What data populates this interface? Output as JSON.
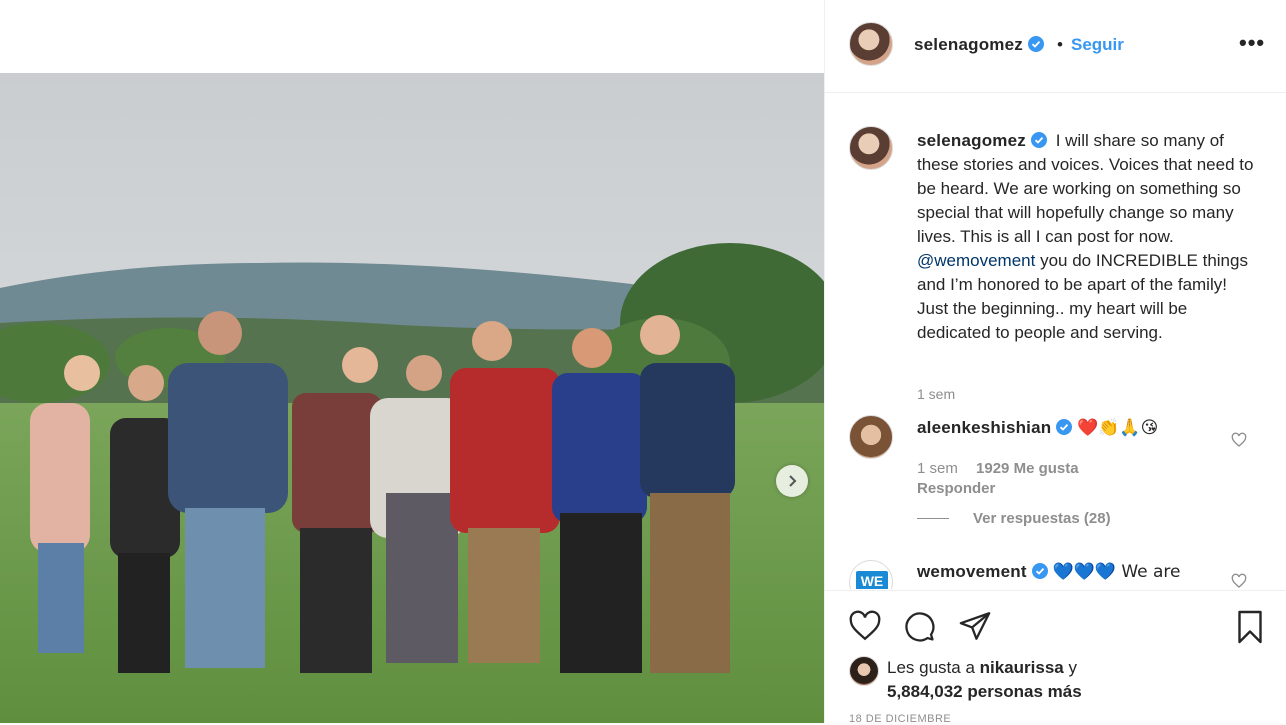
{
  "post": {
    "username": "selenagomez",
    "follow_label": "Seguir",
    "separator": "•",
    "more_label": "•••"
  },
  "caption": {
    "username": "selenagomez",
    "text_before": "I will share so many of these stories and voices. Voices that need to be heard. We are working on something so special that will hopefully change so many lives. This is all I can post for now.",
    "mention": "@wemovement",
    "text_after": "you do INCREDIBLE things and I’m honored to be apart of the family! Just the beginning.. my heart will be dedicated to people and serving.",
    "time": "1 sem"
  },
  "comments": [
    {
      "username": "aleenkeshishian",
      "text": "❤️👏🙏😘",
      "time": "1 sem",
      "likes": "1929 Me gusta",
      "reply_label": "Responder",
      "view_replies": "Ver respuestas (28)"
    },
    {
      "username": "wemovement",
      "avatar_text": "WE",
      "text": "💙💙💙 We are"
    }
  ],
  "likes": {
    "prefix": "Les gusta a",
    "liker": "nikaurissa",
    "suffix": "y",
    "others": "5,884,032 personas más"
  },
  "date": "18 DE DICIEMBRE",
  "colors": {
    "link": "#3897f0",
    "mention": "#003569",
    "muted": "#8e8e8e",
    "heart": "#ed4956"
  },
  "icons": [
    "verified-icon",
    "next-arrow-icon",
    "heart-icon",
    "comment-icon",
    "share-icon",
    "bookmark-icon"
  ]
}
